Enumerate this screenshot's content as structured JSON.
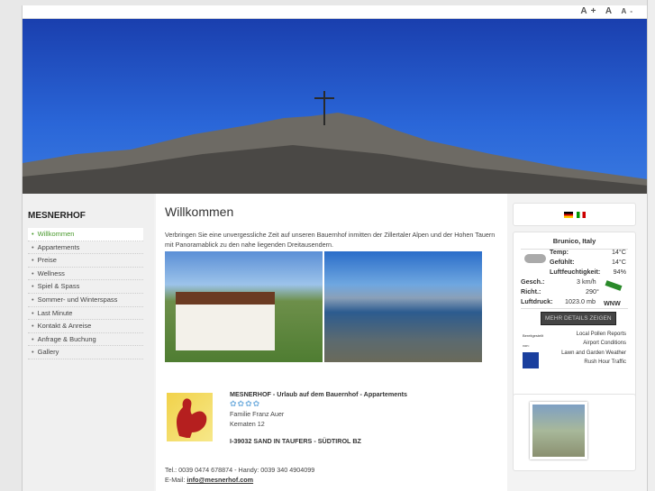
{
  "header": {
    "font_larger": "A+",
    "font_normal": "A",
    "font_smaller": "A-"
  },
  "sidebar": {
    "title": "MESNERHOF",
    "items": [
      {
        "label": "Willkommen",
        "active": true
      },
      {
        "label": "Appartements"
      },
      {
        "label": "Preise"
      },
      {
        "label": "Wellness"
      },
      {
        "label": "Spiel & Spass"
      },
      {
        "label": "Sommer- und Winterspass"
      },
      {
        "label": "Last Minute"
      },
      {
        "label": "Kontakt & Anreise"
      },
      {
        "label": "Anfrage & Buchung"
      },
      {
        "label": "Gallery"
      }
    ]
  },
  "main": {
    "title": "Willkommen",
    "intro": "Verbringen Sie eine unvergessliche Zeit auf unseren Bauernhof inmitten der Zillertaler Alpen und der Hohen Tauern mit Panoramablick zu den nahe liegenden Dreitausendern.",
    "contact": {
      "name": "MESNERHOF - Urlaub auf dem Bauernhof - Appartements",
      "flowers": "✿✿✿✿",
      "family": "Familie Franz Auer",
      "street": "Kematen 12",
      "city": "I-39032 SAND IN TAUFERS - SÜDTIROL BZ",
      "tel": "Tel.: 0039 0474 678874 - Handy: 0039 340 4904099",
      "email_label": "E-Mail: ",
      "email": "info@mesnerhof.com"
    }
  },
  "weather": {
    "location": "Brunico, Italy",
    "temp_label": "Temp:",
    "temp": "14°C",
    "felt_label": "Gefühlt:",
    "felt": "14°C",
    "humidity_label": "Luftfeuchtigkeit:",
    "humidity": "94%",
    "speed_label": "Gesch.:",
    "speed": "3 km/h",
    "dir_label": "Richt.:",
    "dir": "290°",
    "pressure_label": "Luftdruck:",
    "pressure": "1023.0 mb",
    "wind": "WNW",
    "button": "MEHR DETAILS ZEIGEN",
    "sponsor1": "Bereitgestellt",
    "sponsor2": "von:",
    "links": [
      "Local Pollen Reports",
      "Airport Conditions",
      "Lawn and Garden Weather",
      "Rush Hour Traffic"
    ]
  }
}
